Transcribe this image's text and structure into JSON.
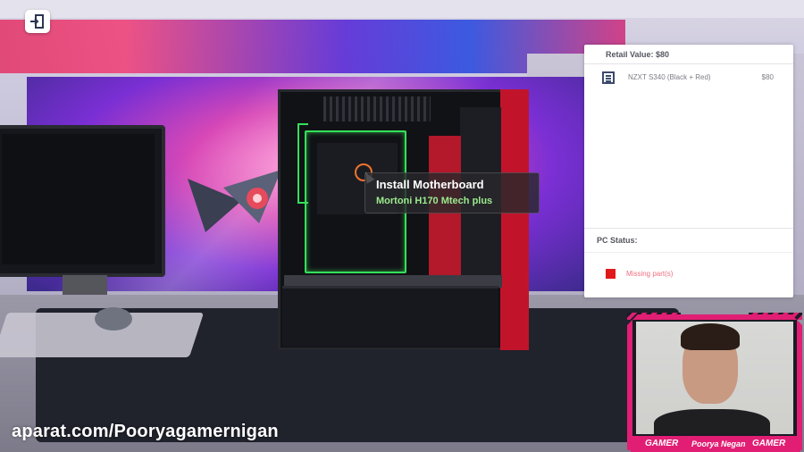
{
  "tooltip": {
    "title": "Install Motherboard",
    "subtitle": "Mortoni H170 Mtech plus"
  },
  "panel": {
    "retail_value": "Retail Value: $80",
    "parts": [
      {
        "icon": "case-icon",
        "name": "NZXT S340 (Black + Red)",
        "price": "$80"
      }
    ],
    "status_label": "PC Status:",
    "status_text": "Missing part(s)",
    "status_color": "#e01a1a"
  },
  "webcam": {
    "labels": [
      "GAMER",
      "Poorya Negan",
      "GAMER"
    ],
    "accent_color": "#e11e74"
  },
  "watermark": "aparat.com/Pooryagamernigan",
  "icons": {
    "exit": "exit-door-icon",
    "cursor": "cursor-ring-icon"
  }
}
